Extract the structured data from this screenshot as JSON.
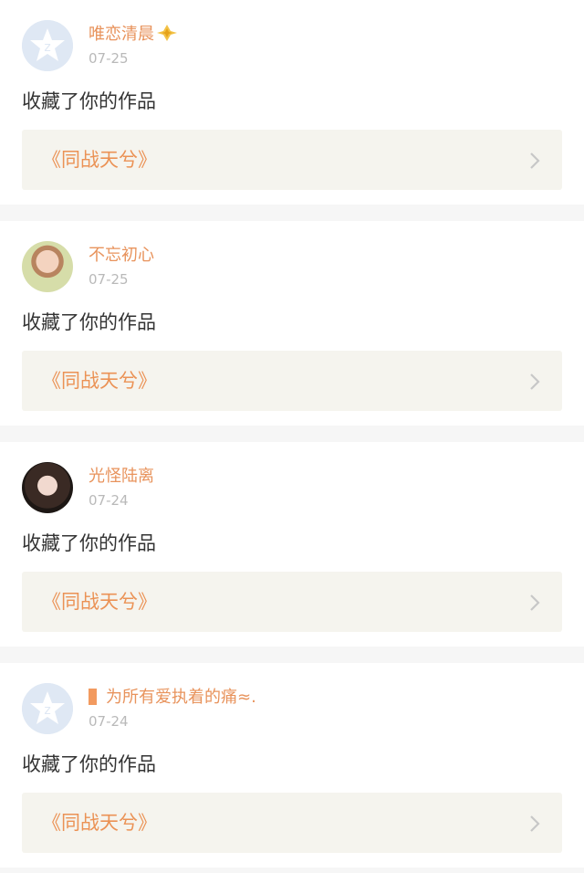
{
  "feed": {
    "items": [
      {
        "user": "唯恋清晨",
        "date": "07-25",
        "action": "收藏了你的作品",
        "work_title": "《同战天兮》",
        "avatar": "default-avatar",
        "badge": "diamond-badge-icon"
      },
      {
        "user": "不忘初心",
        "date": "07-25",
        "action": "收藏了你的作品",
        "work_title": "《同战天兮》",
        "avatar": "photo-avatar"
      },
      {
        "user": "光怪陆离",
        "date": "07-24",
        "action": "收藏了你的作品",
        "work_title": "《同战天兮》",
        "avatar": "photo-avatar"
      },
      {
        "user": "为所有爱执着的痛≈.",
        "date": "07-24",
        "action": "收藏了你的作品",
        "work_title": "《同战天兮》",
        "avatar": "default-avatar",
        "prefix_icon": "orange-bar-icon"
      }
    ]
  },
  "colors": {
    "username": "#e8935c",
    "date": "#b9b9b9",
    "work_title": "#eb9255",
    "work_bg": "#f5f4ee",
    "separator": "#f6f6f6"
  }
}
